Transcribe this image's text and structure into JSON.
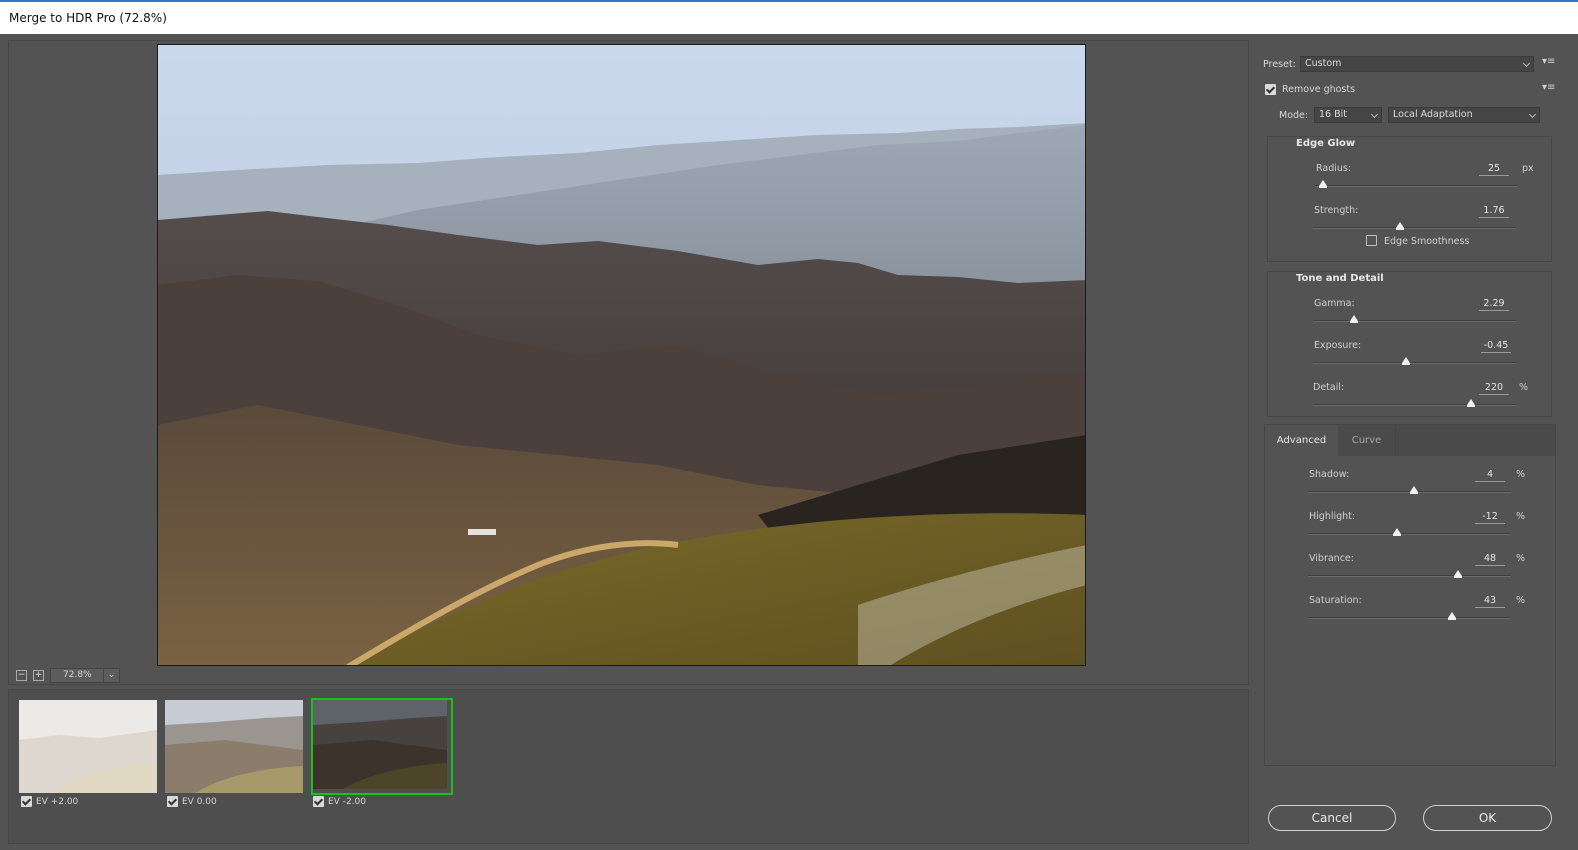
{
  "window": {
    "title": "Merge to HDR Pro (72.8%)"
  },
  "zoom": {
    "minus": "−",
    "plus": "+",
    "value": "72.8%"
  },
  "thumbnails": [
    {
      "label": "EV +2.00",
      "checked": true,
      "selected": false
    },
    {
      "label": "EV 0.00",
      "checked": true,
      "selected": false
    },
    {
      "label": "EV -2.00",
      "checked": true,
      "selected": true
    }
  ],
  "settings": {
    "preset_label": "Preset:",
    "preset_value": "Custom",
    "remove_ghosts_label": "Remove ghosts",
    "remove_ghosts_checked": true,
    "mode_label": "Mode:",
    "mode_bit": "16 Bit",
    "mode_method": "Local Adaptation"
  },
  "edge_glow": {
    "title": "Edge Glow",
    "radius": {
      "label": "Radius:",
      "value": "25",
      "unit": "px",
      "fraction": 0.04
    },
    "strength": {
      "label": "Strength:",
      "value": "1.76",
      "fraction": 0.43
    },
    "edge_smoothness_label": "Edge Smoothness",
    "edge_smoothness_checked": false
  },
  "tone_detail": {
    "title": "Tone and Detail",
    "gamma": {
      "label": "Gamma:",
      "value": "2.29",
      "fraction": 0.2
    },
    "exposure": {
      "label": "Exposure:",
      "value": "-0.45",
      "fraction": 0.46
    },
    "detail": {
      "label": "Detail:",
      "value": "220",
      "unit": "%",
      "fraction": 0.78
    }
  },
  "tabs": {
    "advanced": "Advanced",
    "curve": "Curve"
  },
  "advanced": {
    "shadow": {
      "label": "Shadow:",
      "value": "4",
      "unit": "%",
      "fraction": 0.52
    },
    "highlight": {
      "label": "Highlight:",
      "value": "-12",
      "unit": "%",
      "fraction": 0.44
    },
    "vibrance": {
      "label": "Vibrance:",
      "value": "48",
      "unit": "%",
      "fraction": 0.74
    },
    "saturation": {
      "label": "Saturation:",
      "value": "43",
      "unit": "%",
      "fraction": 0.71
    }
  },
  "buttons": {
    "cancel": "Cancel",
    "ok": "OK"
  },
  "icons": {
    "panel_menu": "menu-list-icon",
    "chevron": "chevron-down-icon"
  }
}
